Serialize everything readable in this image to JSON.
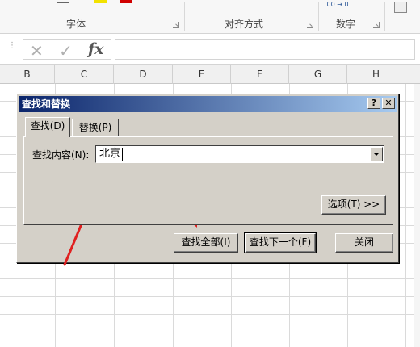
{
  "ribbon": {
    "groups": [
      {
        "label": "字体"
      },
      {
        "label": "对齐方式"
      },
      {
        "label": "数字"
      }
    ],
    "number_format_hint": ".00 →.0"
  },
  "formula_bar": {
    "cancel_icon": "✕",
    "enter_icon": "✓",
    "fx_label": "fx",
    "value": ""
  },
  "sheet": {
    "columns": [
      "B",
      "C",
      "D",
      "E",
      "F",
      "G",
      "H"
    ]
  },
  "dialog": {
    "title": "查找和替换",
    "help_label": "?",
    "close_label": "✕",
    "tabs": [
      {
        "label": "查找(D)",
        "active": true
      },
      {
        "label": "替换(P)",
        "active": false
      }
    ],
    "find_label": "查找内容(N):",
    "find_value": "北京",
    "options_button": "选项(T) >>",
    "find_all_button": "查找全部(I)",
    "find_next_button": "查找下一个(F)",
    "close_button": "关闭"
  },
  "annotations": {
    "arrow_color": "#e02020"
  }
}
